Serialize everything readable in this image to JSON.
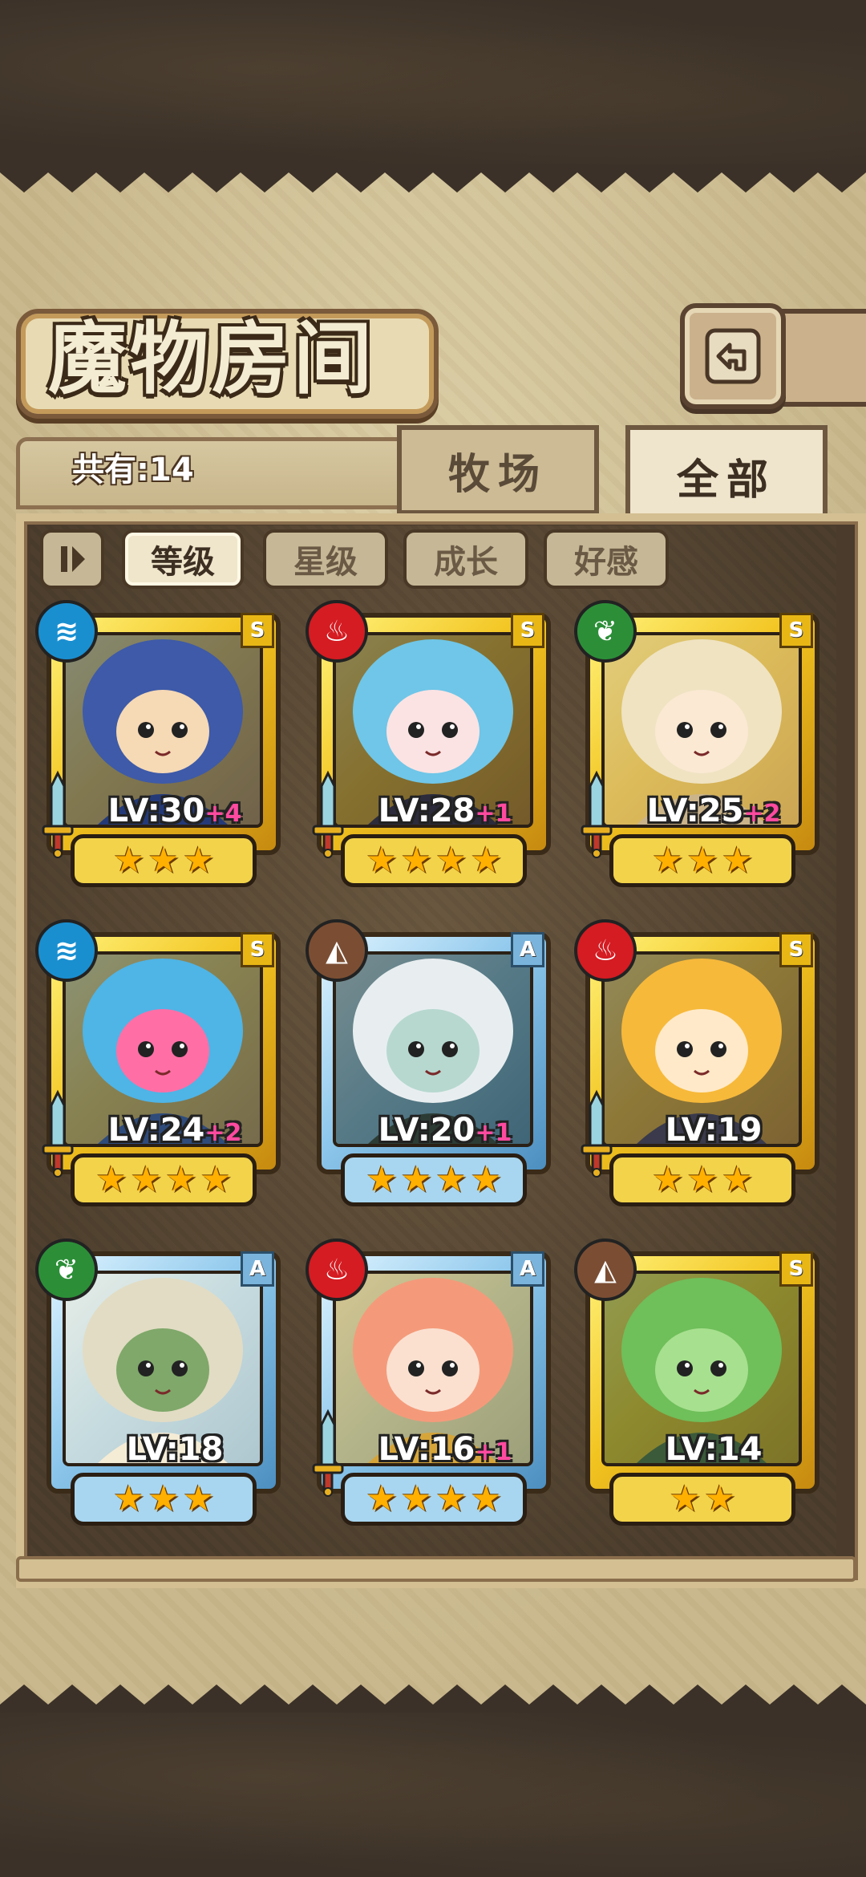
{
  "header": {
    "title": "魔物房间"
  },
  "summary": {
    "count_label": "共有:14"
  },
  "tabs": [
    {
      "label": "牧场"
    },
    {
      "label": "全部"
    }
  ],
  "sort": [
    {
      "label": "等级",
      "active": true
    },
    {
      "label": "星级",
      "active": false
    },
    {
      "label": "成长",
      "active": false
    },
    {
      "label": "好感",
      "active": false
    }
  ],
  "monsters": [
    {
      "element": "water",
      "rank": "S",
      "level": "LV:30",
      "bonus": "+4",
      "stars": 3,
      "frame": "gold",
      "weapon": true,
      "art": [
        "#3e5aa8",
        "#f6d9b5",
        "#243a78"
      ]
    },
    {
      "element": "fire",
      "rank": "S",
      "level": "LV:28",
      "bonus": "+1",
      "stars": 4,
      "frame": "gold",
      "weapon": true,
      "art": [
        "#6fc6e8",
        "#fbe3e3",
        "#2b2b3c"
      ]
    },
    {
      "element": "leaf",
      "rank": "S",
      "level": "LV:25",
      "bonus": "+2",
      "stars": 3,
      "frame": "gold",
      "weapon": true,
      "art": [
        "#efe3c2",
        "#fbe9d3",
        "#cbb48a"
      ]
    },
    {
      "element": "water",
      "rank": "S",
      "level": "LV:24",
      "bonus": "+2",
      "stars": 4,
      "frame": "gold",
      "weapon": true,
      "art": [
        "#4fb4e6",
        "#ff6fa6",
        "#2f4b7a"
      ]
    },
    {
      "element": "earth",
      "rank": "A",
      "level": "LV:20",
      "bonus": "+1",
      "stars": 4,
      "frame": "blue",
      "weapon": false,
      "art": [
        "#e8eef0",
        "#b7d8cf",
        "#2c3c34"
      ]
    },
    {
      "element": "fire",
      "rank": "S",
      "level": "LV:19",
      "bonus": "",
      "stars": 3,
      "frame": "gold",
      "weapon": true,
      "art": [
        "#f7b93a",
        "#ffe9c8",
        "#3a3a4c"
      ]
    },
    {
      "element": "leaf",
      "rank": "A",
      "level": "LV:18",
      "bonus": "",
      "stars": 3,
      "frame": "blue",
      "weapon": false,
      "art": [
        "#e2dcc4",
        "#7fa86a",
        "#f5ecd6"
      ]
    },
    {
      "element": "fire",
      "rank": "A",
      "level": "LV:16",
      "bonus": "+1",
      "stars": 4,
      "frame": "blue",
      "weapon": true,
      "art": [
        "#f49a7a",
        "#fbe0d0",
        "#d6a53a"
      ]
    },
    {
      "element": "earth",
      "rank": "S",
      "level": "LV:14",
      "bonus": "",
      "stars": 2,
      "frame": "gold",
      "weapon": false,
      "art": [
        "#6fbf5a",
        "#a7e08f",
        "#3b5a3a"
      ]
    }
  ]
}
